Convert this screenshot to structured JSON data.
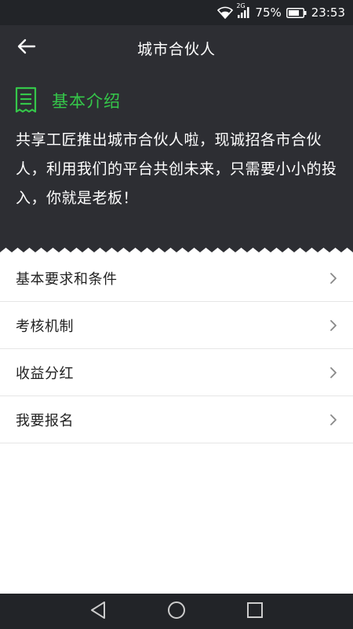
{
  "status_bar": {
    "network_type": "2G",
    "battery_percent": "75%",
    "time": "23:53",
    "icons": [
      "wifi-icon",
      "signal-icon",
      "battery-icon"
    ]
  },
  "header": {
    "title": "城市合伙人",
    "back_icon": "back-arrow-icon"
  },
  "intro": {
    "icon": "receipt-icon",
    "title": "基本介绍",
    "text": "共享工匠推出城市合伙人啦，现诚招各市合伙人，利用我们的平台共创未来，只需要小小的投入，你就是老板！",
    "accent_color": "#35c74a",
    "background_color": "#2d2e33"
  },
  "menu": {
    "items": [
      {
        "label": "基本要求和条件",
        "icon": "chevron-right-icon"
      },
      {
        "label": "考核机制",
        "icon": "chevron-right-icon"
      },
      {
        "label": "收益分红",
        "icon": "chevron-right-icon"
      },
      {
        "label": "我要报名",
        "icon": "chevron-right-icon"
      }
    ]
  },
  "nav_bar": {
    "buttons": [
      "back-triangle-icon",
      "home-circle-icon",
      "recents-square-icon"
    ]
  }
}
